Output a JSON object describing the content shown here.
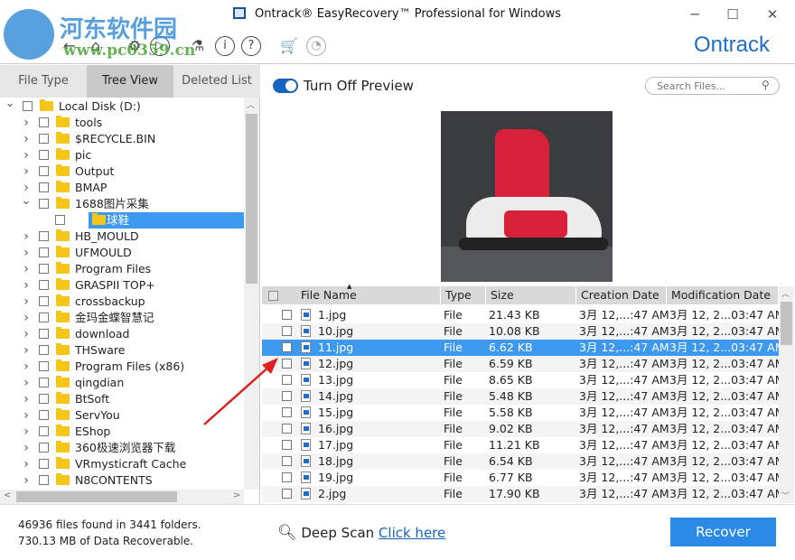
{
  "window": {
    "title": "Ontrack® EasyRecovery™ Professional for Windows",
    "brand": "Ontrack",
    "watermark": "河东软件园 www.pc0359.cn"
  },
  "toolbar": {
    "icons": [
      "back-icon",
      "home-icon",
      "gear-icon",
      "restore-icon",
      "microscope-icon",
      "info-icon",
      "help-icon",
      "cart-icon",
      "user-icon"
    ]
  },
  "tabs": [
    {
      "label": "File Type"
    },
    {
      "label": "Tree View",
      "active": true
    },
    {
      "label": "Deleted List"
    }
  ],
  "tree": [
    {
      "label": "Local Disk (D:)",
      "level": 0,
      "expanded": true
    },
    {
      "label": "tools",
      "level": 1
    },
    {
      "label": "$RECYCLE.BIN",
      "level": 1
    },
    {
      "label": "pic",
      "level": 1
    },
    {
      "label": "Output",
      "level": 1
    },
    {
      "label": "BMAP",
      "level": 1
    },
    {
      "label": "1688图片采集",
      "level": 1,
      "expanded": true
    },
    {
      "label": "球鞋",
      "level": 2,
      "selected": true
    },
    {
      "label": "HB_MOULD",
      "level": 1
    },
    {
      "label": "UFMOULD",
      "level": 1
    },
    {
      "label": "Program Files",
      "level": 1
    },
    {
      "label": "GRASPII TOP+",
      "level": 1
    },
    {
      "label": "crossbackup",
      "level": 1
    },
    {
      "label": "金玛金蝶智慧记",
      "level": 1
    },
    {
      "label": "download",
      "level": 1
    },
    {
      "label": "THSware",
      "level": 1
    },
    {
      "label": "Program Files (x86)",
      "level": 1
    },
    {
      "label": "qingdian",
      "level": 1
    },
    {
      "label": "BtSoft",
      "level": 1
    },
    {
      "label": "ServYou",
      "level": 1
    },
    {
      "label": "EShop",
      "level": 1
    },
    {
      "label": "360极速浏览器下载",
      "level": 1
    },
    {
      "label": "VRmysticraft Cache",
      "level": 1
    },
    {
      "label": "N8CONTENTS",
      "level": 1
    }
  ],
  "preview": {
    "toggle_label": "Turn Off Preview",
    "toggle_on": true,
    "search_placeholder": "Search Files..."
  },
  "table": {
    "columns": [
      "File Name",
      "Type",
      "Size",
      "Creation Date",
      "Modification Date"
    ],
    "sort_column": "File Name",
    "rows": [
      {
        "name": "1.jpg",
        "type": "File",
        "size": "21.43 KB",
        "created": "3月 12,...:47 AM",
        "modified": "3月 12, 2...03:47 AM"
      },
      {
        "name": "10.jpg",
        "type": "File",
        "size": "10.08 KB",
        "created": "3月 12,...:47 AM",
        "modified": "3月 12, 2...03:47 AM"
      },
      {
        "name": "11.jpg",
        "type": "File",
        "size": "6.62 KB",
        "created": "3月 12,...:47 AM",
        "modified": "3月 12, 2...03:47 AM",
        "selected": true
      },
      {
        "name": "12.jpg",
        "type": "File",
        "size": "6.59 KB",
        "created": "3月 12,...:47 AM",
        "modified": "3月 12, 2...03:47 AM"
      },
      {
        "name": "13.jpg",
        "type": "File",
        "size": "8.65 KB",
        "created": "3月 12,...:47 AM",
        "modified": "3月 12, 2...03:47 AM"
      },
      {
        "name": "14.jpg",
        "type": "File",
        "size": "5.48 KB",
        "created": "3月 12,...:47 AM",
        "modified": "3月 12, 2...03:47 AM"
      },
      {
        "name": "15.jpg",
        "type": "File",
        "size": "5.58 KB",
        "created": "3月 12,...:47 AM",
        "modified": "3月 12, 2...03:47 AM"
      },
      {
        "name": "16.jpg",
        "type": "File",
        "size": "9.02 KB",
        "created": "3月 12,...:47 AM",
        "modified": "3月 12, 2...03:47 AM"
      },
      {
        "name": "17.jpg",
        "type": "File",
        "size": "11.21 KB",
        "created": "3月 12,...:47 AM",
        "modified": "3月 12, 2...03:47 AM"
      },
      {
        "name": "18.jpg",
        "type": "File",
        "size": "6.54 KB",
        "created": "3月 12,...:47 AM",
        "modified": "3月 12, 2...03:47 AM"
      },
      {
        "name": "19.jpg",
        "type": "File",
        "size": "6.77 KB",
        "created": "3月 12,...:47 AM",
        "modified": "3月 12, 2...03:47 AM"
      },
      {
        "name": "2.jpg",
        "type": "File",
        "size": "17.90 KB",
        "created": "3月 12,...:47 AM",
        "modified": "3月 12, 2...03:47 AM"
      }
    ]
  },
  "footer": {
    "files_found": "46936 files found in 3441 folders.",
    "data_recoverable": "730.13 MB of Data Recoverable.",
    "deep_scan_label": "Deep Scan",
    "deep_scan_link": "Click here",
    "recover_label": "Recover"
  },
  "colors": {
    "accent": "#2b8ae6",
    "selection": "#3d99f0",
    "brand": "#1d6fc4"
  }
}
